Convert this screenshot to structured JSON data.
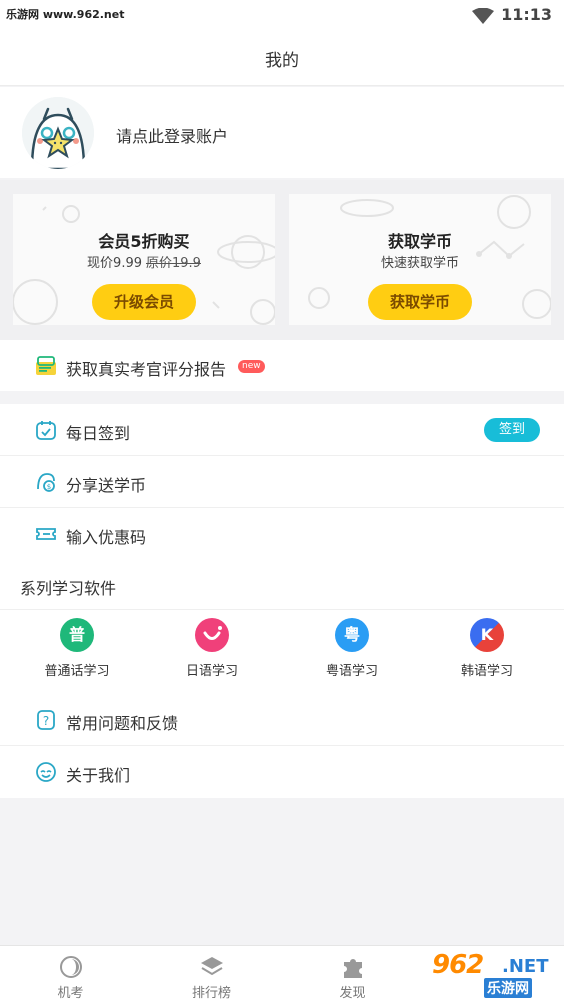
{
  "status_bar": {
    "watermark": "乐游网 www.962.net",
    "time": "11:13"
  },
  "header": {
    "title": "我的"
  },
  "profile": {
    "login_prompt": "请点此登录账户"
  },
  "promos": [
    {
      "title": "会员5折购买",
      "price_now": "现价9.99",
      "price_original": "原价19.9",
      "button": "升级会员"
    },
    {
      "title": "获取学币",
      "subtitle": "快速获取学币",
      "button": "获取学币"
    }
  ],
  "report": {
    "label": "获取真实考官评分报告",
    "badge": "new"
  },
  "menu": {
    "checkin": {
      "label": "每日签到",
      "button": "签到"
    },
    "share": {
      "label": "分享送学币"
    },
    "coupon": {
      "label": "输入优惠码"
    }
  },
  "series": {
    "heading": "系列学习软件",
    "apps": [
      {
        "label": "普通话学习",
        "glyph": "普",
        "color": "#1fb87a"
      },
      {
        "label": "日语学习",
        "glyph": "◡",
        "color": "#f0407a"
      },
      {
        "label": "粤语学习",
        "glyph": "粤",
        "color": "#2a9df4"
      },
      {
        "label": "韩语学习",
        "glyph": "K",
        "color": "#e8423a"
      }
    ]
  },
  "help": {
    "faq": {
      "label": "常用问题和反馈"
    },
    "about": {
      "label": "关于我们"
    }
  },
  "tabs": [
    {
      "label": "机考",
      "icon": "exam-icon"
    },
    {
      "label": "排行榜",
      "icon": "layers-icon"
    },
    {
      "label": "发现",
      "icon": "puzzle-icon"
    },
    {
      "label": "",
      "icon": "profile-icon"
    }
  ],
  "watermark_bottom": {
    "number": "962",
    "net": ".NET",
    "cn": "乐游网"
  },
  "colors": {
    "accent_yellow": "#ffcd12",
    "accent_teal": "#18bdd8",
    "badge_red": "#ff5b5b"
  }
}
